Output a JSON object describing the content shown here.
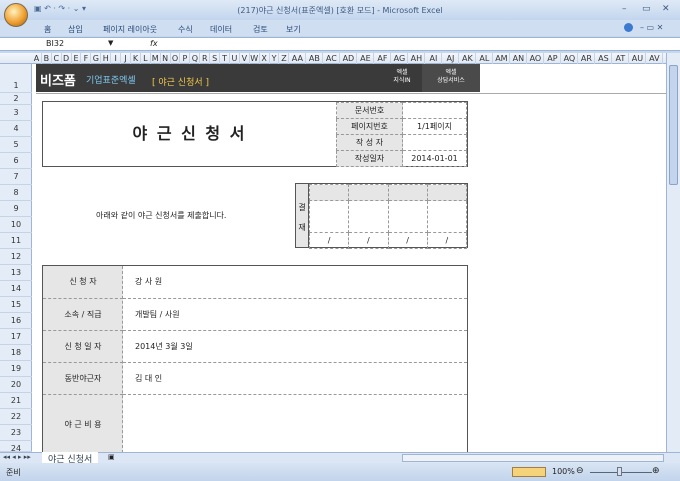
{
  "window": {
    "title": "(217)야근 신청서(표준엑셀)  [호환 모드] - Microsoft Excel",
    "qat": "▣ ↶ · ↷ · ⌄ ▾"
  },
  "ribbon_tabs": [
    "홈",
    "삽입",
    "페이지 레이아웃",
    "수식",
    "데이터",
    "검토",
    "보기"
  ],
  "formula_bar": {
    "name_box": "BI32",
    "fx": "fx",
    "value": ""
  },
  "columns": [
    "A",
    "B",
    "C",
    "D",
    "E",
    "F",
    "G",
    "H",
    "I",
    "J",
    "K",
    "L",
    "M",
    "N",
    "O",
    "P",
    "Q",
    "R",
    "S",
    "T",
    "U",
    "V",
    "W",
    "X",
    "Y",
    "Z",
    "AA",
    "AB",
    "AC",
    "AD",
    "AE",
    "AF",
    "AG",
    "AH",
    "AI",
    "AJ",
    "AK",
    "AL",
    "AM",
    "AN",
    "AO",
    "AP",
    "AQ",
    "AR",
    "AS",
    "AT",
    "AU",
    "AV"
  ],
  "rows": [
    "1",
    "2",
    "3",
    "4",
    "5",
    "6",
    "7",
    "8",
    "9",
    "10",
    "11",
    "12",
    "13",
    "14",
    "15",
    "16",
    "17",
    "18",
    "19",
    "20",
    "21",
    "22",
    "23",
    "24"
  ],
  "banner": {
    "logo": "비즈폼",
    "subtitle": "기업표준엑셀",
    "doc_title": "[ 야근 신청서 ]",
    "btn1_l1": "엑셀",
    "btn1_l2": "지식IN",
    "btn2_l1": "엑셀",
    "btn2_l2": "상담서비스"
  },
  "doc": {
    "title": "야 근 신 청 서",
    "fields": [
      {
        "label": "문서번호",
        "value": ""
      },
      {
        "label": "페이지번호",
        "value": "1/1페이지"
      },
      {
        "label": "작 성 자",
        "value": ""
      },
      {
        "label": "작성일자",
        "value": "2014-01-01"
      }
    ]
  },
  "notice": "아래와 같이 야근 신청서를 제출합니다.",
  "approval": {
    "label1": "결",
    "label2": "재",
    "date_mark": "/"
  },
  "info": [
    {
      "label": "신 청 자",
      "value": "강 사 원"
    },
    {
      "label": "소속 / 직급",
      "value": "개발팀 / 사원"
    },
    {
      "label": "신 청 일 자",
      "value": "2014년 3월 3일"
    },
    {
      "label": "동반야근자",
      "value": "김 대 인"
    },
    {
      "label": "야 근 비 용",
      "value": ""
    }
  ],
  "sheet_tab": "야근 신청서",
  "status": {
    "ready": "준비",
    "zoom": "100%"
  }
}
